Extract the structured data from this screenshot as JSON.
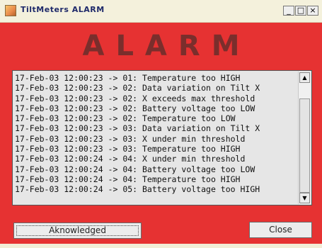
{
  "window": {
    "title": "TiltMeters ALARM",
    "controls": {
      "minimize": "_",
      "maximize": "□",
      "close": "×"
    }
  },
  "header": {
    "text": "ALARM"
  },
  "log": {
    "entries": [
      "17-Feb-03 12:00:23 -> 01: Temperature too HIGH",
      "17-Feb-03 12:00:23 -> 02: Data variation on Tilt X",
      "17-Feb-03 12:00:23 -> 02: X exceeds max threshold",
      "17-Feb-03 12:00:23 -> 02: Battery voltage too LOW",
      "17-Feb-03 12:00:23 -> 02: Temperature too LOW",
      "17-Feb-03 12:00:23 -> 03: Data variation on Tilt X",
      "17-Feb-03 12:00:23 -> 03: X under min threshold",
      "17-Feb-03 12:00:23 -> 03: Temperature too HIGH",
      "17-Feb-03 12:00:24 -> 04: X under min threshold",
      "17-Feb-03 12:00:24 -> 04: Battery voltage too LOW",
      "17-Feb-03 12:00:24 -> 04: Temperature too HIGH",
      "17-Feb-03 12:00:24 -> 05: Battery voltage too HIGH"
    ]
  },
  "buttons": {
    "acknowledged": "Aknowledged",
    "close": "Close"
  },
  "colors": {
    "background": "#e63232",
    "header_text": "#7a2e2c",
    "titlebar": "#f4f1dc",
    "title_text": "#1f2a6a"
  }
}
